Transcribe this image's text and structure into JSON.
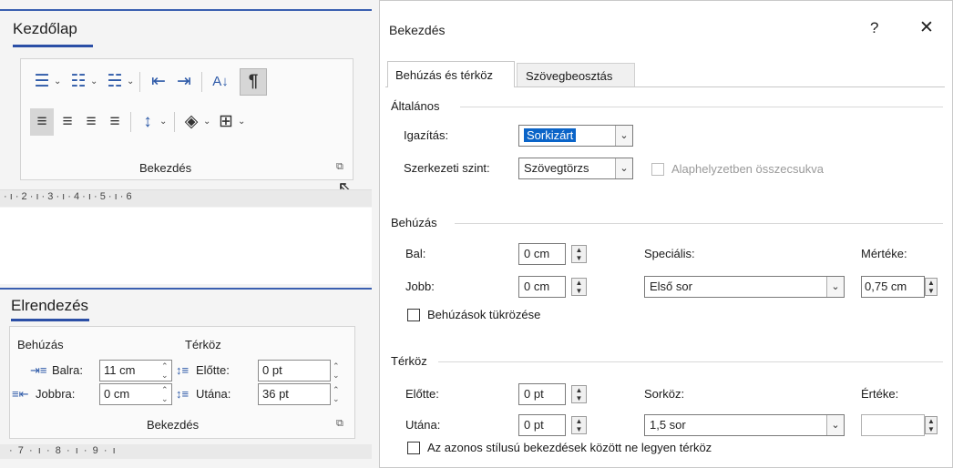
{
  "ribbon_home": {
    "tab_label": "Kezdőlap",
    "group_label": "Bekezdés",
    "ruler_text": "· ı · 2 · ı · 3 · ı · 4 · ı · 5 · ı · 6"
  },
  "ribbon_layout": {
    "tab_label": "Elrendezés",
    "indent_label": "Behúzás",
    "spacing_label": "Térköz",
    "left_label": "Balra:",
    "left_value": "11 cm",
    "right_label": "Jobbra:",
    "right_value": "0 cm",
    "before_label": "Előtte:",
    "before_value": "0 pt",
    "after_label": "Utána:",
    "after_value": "36 pt",
    "group_label": "Bekezdés",
    "ruler_text": "·  7  ·  ı  ·  8  ·  ı  ·  9  ·  ı"
  },
  "dialog": {
    "title": "Bekezdés",
    "help": "?",
    "close": "✕",
    "tabs": [
      "Behúzás és térköz",
      "Szövegbeosztás"
    ],
    "general": {
      "heading": "Általános",
      "alignment_label": "Igazítás:",
      "alignment_value": "Sorkizárt",
      "outline_label": "Szerkezeti szint:",
      "outline_value": "Szövegtörzs",
      "collapsed_label": "Alaphelyzetben összecsukva"
    },
    "indent": {
      "heading": "Behúzás",
      "left_label": "Bal:",
      "left_value": "0 cm",
      "right_label": "Jobb:",
      "right_value": "0 cm",
      "special_label": "Speciális:",
      "special_value": "Első sor",
      "by_label": "Mértéke:",
      "by_value": "0,75 cm",
      "mirror_label": "Behúzások tükrözése"
    },
    "spacing": {
      "heading": "Térköz",
      "before_label": "Előtte:",
      "before_value": "0 pt",
      "after_label": "Utána:",
      "after_value": "0 pt",
      "line_label": "Sorköz:",
      "line_value": "1,5 sor",
      "at_label": "Értéke:",
      "at_value": "",
      "no_space_label": "Az azonos stílusú bekezdések között ne legyen térköz"
    }
  }
}
